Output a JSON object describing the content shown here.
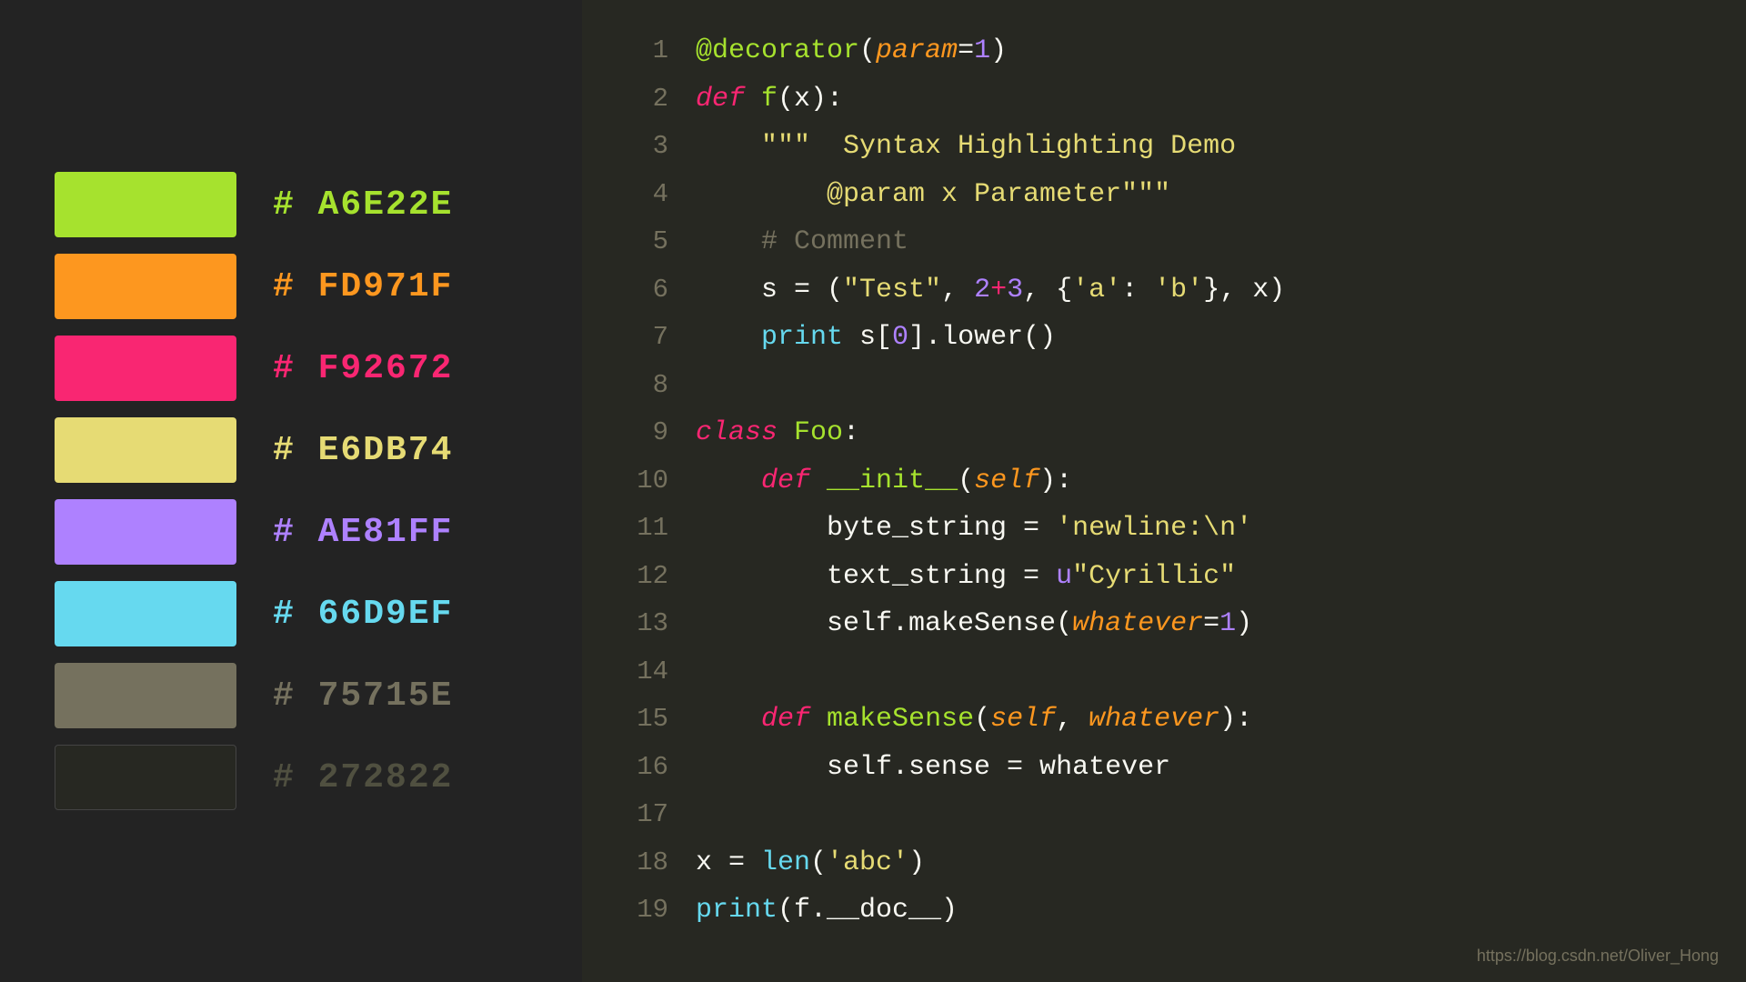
{
  "left": {
    "swatches": [
      {
        "color": "#A6E22E",
        "label": "# A6E22E",
        "label_color": "#A6E22E"
      },
      {
        "color": "#FD971F",
        "label": "# FD971F",
        "label_color": "#FD971F"
      },
      {
        "color": "#F92672",
        "label": "# F92672",
        "label_color": "#F92672"
      },
      {
        "color": "#E6DB74",
        "label": "# E6DB74",
        "label_color": "#E6DB74"
      },
      {
        "color": "#AE81FF",
        "label": "# AE81FF",
        "label_color": "#AE81FF"
      },
      {
        "color": "#66D9EF",
        "label": "# 66D9EF",
        "label_color": "#66D9EF"
      },
      {
        "color": "#75715E",
        "label": "# 75715E",
        "label_color": "#75715e"
      },
      {
        "color": "#272822",
        "label": "# 272822",
        "label_color": "#505040"
      }
    ]
  },
  "watermark": "https://blog.csdn.net/Oliver_Hong"
}
